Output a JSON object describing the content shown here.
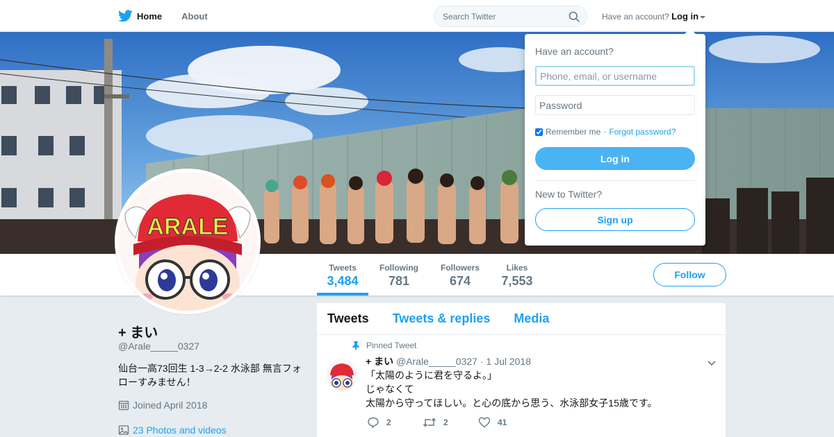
{
  "nav": {
    "home": "Home",
    "about": "About",
    "search_placeholder": "Search Twitter",
    "have_account": "Have an account?",
    "login": "Log in"
  },
  "profile": {
    "name": "+ まい",
    "handle": "@Arale_____0327",
    "bio": "仙台一高73回生 1-3→2-2 水泳部 無言フォローすみません！",
    "joined": "Joined April 2018",
    "photos": "23 Photos and videos",
    "avatar_text": "ARALE"
  },
  "stats": [
    {
      "label": "Tweets",
      "value": "3,484",
      "active": true
    },
    {
      "label": "Following",
      "value": "781",
      "active": false
    },
    {
      "label": "Followers",
      "value": "674",
      "active": false
    },
    {
      "label": "Likes",
      "value": "7,553",
      "active": false
    }
  ],
  "follow_button": "Follow",
  "timeline": {
    "tabs": [
      "Tweets",
      "Tweets & replies",
      "Media"
    ],
    "tweet": {
      "pinned": "Pinned Tweet",
      "name": "+ まい",
      "handle": "@Arale_____0327",
      "date": "· 1 Jul 2018",
      "lines": [
        "「太陽のように君を守るよ。」",
        "じゃなくて",
        "太陽から守ってほしい。と心の底から思う、水泳部女子15歳です。"
      ],
      "replies": "2",
      "retweets": "2",
      "likes": "41"
    }
  },
  "login_dropdown": {
    "title": "Have an account?",
    "username_placeholder": "Phone, email, or username",
    "password_placeholder": "Password",
    "remember": "Remember me",
    "separator": "·",
    "forgot": "Forgot password?",
    "login_button": "Log in",
    "new_to": "New to Twitter?",
    "signup_button": "Sign up"
  },
  "colors": {
    "brand": "#1da1f2",
    "text": "#14171a",
    "muted": "#657786",
    "background": "#e6ecf0"
  }
}
